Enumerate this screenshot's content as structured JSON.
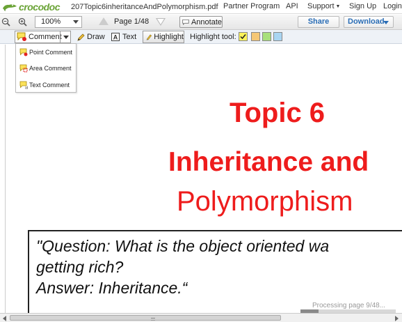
{
  "topbar": {
    "brand": "crocodoc",
    "filename": "207Topic6inheritanceAndPolymorphism.pdf",
    "nav": {
      "partner": "Partner Program",
      "api": "API",
      "support": "Support",
      "signup": "Sign Up",
      "login": "Login"
    }
  },
  "toolbar": {
    "zoom": "100%",
    "page_indicator": "Page 1/48",
    "annotate": "Annotate",
    "share": "Share",
    "download": "Download"
  },
  "annotation_toolbar": {
    "comment": "Comment",
    "draw": "Draw",
    "text": "Text",
    "highlight": "Highlight",
    "highlight_tool_label": "Highlight tool:",
    "colors": [
      "#fbf35a",
      "#f5c776",
      "#a8e07c",
      "#a9d5f2"
    ]
  },
  "comment_menu": {
    "items": [
      "Point Comment",
      "Area Comment",
      "Text Comment"
    ]
  },
  "document": {
    "title_line1": "Topic 6",
    "title_line2": "Inheritance and",
    "title_line3": "Polymorphism",
    "quote_line1": "\"Question: What is the object oriented wa",
    "quote_line2": "getting rich?",
    "quote_line3": "Answer: Inheritance.“"
  },
  "status": {
    "processing": "Processing page 9/48...",
    "processing_fraction": 0.1875
  },
  "colors": {
    "brand_green": "#6aa336",
    "title_red": "#ee1c1c",
    "link_blue": "#2a6db5"
  }
}
